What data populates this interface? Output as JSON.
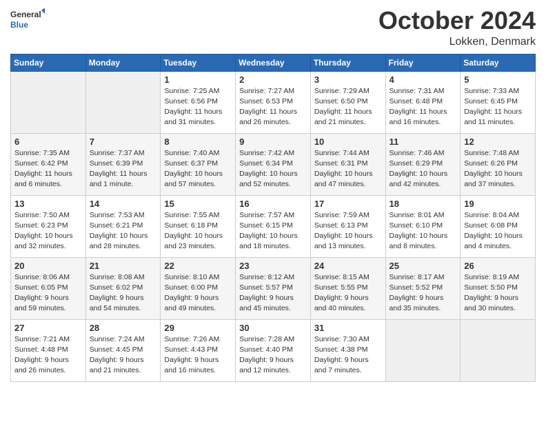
{
  "header": {
    "logo": {
      "general": "General",
      "blue": "Blue"
    },
    "month": "October 2024",
    "location": "Lokken, Denmark"
  },
  "weekdays": [
    "Sunday",
    "Monday",
    "Tuesday",
    "Wednesday",
    "Thursday",
    "Friday",
    "Saturday"
  ],
  "weeks": [
    [
      {
        "day": "",
        "sunrise": "",
        "sunset": "",
        "daylight": ""
      },
      {
        "day": "",
        "sunrise": "",
        "sunset": "",
        "daylight": ""
      },
      {
        "day": "1",
        "sunrise": "Sunrise: 7:25 AM",
        "sunset": "Sunset: 6:56 PM",
        "daylight": "Daylight: 11 hours and 31 minutes."
      },
      {
        "day": "2",
        "sunrise": "Sunrise: 7:27 AM",
        "sunset": "Sunset: 6:53 PM",
        "daylight": "Daylight: 11 hours and 26 minutes."
      },
      {
        "day": "3",
        "sunrise": "Sunrise: 7:29 AM",
        "sunset": "Sunset: 6:50 PM",
        "daylight": "Daylight: 11 hours and 21 minutes."
      },
      {
        "day": "4",
        "sunrise": "Sunrise: 7:31 AM",
        "sunset": "Sunset: 6:48 PM",
        "daylight": "Daylight: 11 hours and 16 minutes."
      },
      {
        "day": "5",
        "sunrise": "Sunrise: 7:33 AM",
        "sunset": "Sunset: 6:45 PM",
        "daylight": "Daylight: 11 hours and 11 minutes."
      }
    ],
    [
      {
        "day": "6",
        "sunrise": "Sunrise: 7:35 AM",
        "sunset": "Sunset: 6:42 PM",
        "daylight": "Daylight: 11 hours and 6 minutes."
      },
      {
        "day": "7",
        "sunrise": "Sunrise: 7:37 AM",
        "sunset": "Sunset: 6:39 PM",
        "daylight": "Daylight: 11 hours and 1 minute."
      },
      {
        "day": "8",
        "sunrise": "Sunrise: 7:40 AM",
        "sunset": "Sunset: 6:37 PM",
        "daylight": "Daylight: 10 hours and 57 minutes."
      },
      {
        "day": "9",
        "sunrise": "Sunrise: 7:42 AM",
        "sunset": "Sunset: 6:34 PM",
        "daylight": "Daylight: 10 hours and 52 minutes."
      },
      {
        "day": "10",
        "sunrise": "Sunrise: 7:44 AM",
        "sunset": "Sunset: 6:31 PM",
        "daylight": "Daylight: 10 hours and 47 minutes."
      },
      {
        "day": "11",
        "sunrise": "Sunrise: 7:46 AM",
        "sunset": "Sunset: 6:29 PM",
        "daylight": "Daylight: 10 hours and 42 minutes."
      },
      {
        "day": "12",
        "sunrise": "Sunrise: 7:48 AM",
        "sunset": "Sunset: 6:26 PM",
        "daylight": "Daylight: 10 hours and 37 minutes."
      }
    ],
    [
      {
        "day": "13",
        "sunrise": "Sunrise: 7:50 AM",
        "sunset": "Sunset: 6:23 PM",
        "daylight": "Daylight: 10 hours and 32 minutes."
      },
      {
        "day": "14",
        "sunrise": "Sunrise: 7:53 AM",
        "sunset": "Sunset: 6:21 PM",
        "daylight": "Daylight: 10 hours and 28 minutes."
      },
      {
        "day": "15",
        "sunrise": "Sunrise: 7:55 AM",
        "sunset": "Sunset: 6:18 PM",
        "daylight": "Daylight: 10 hours and 23 minutes."
      },
      {
        "day": "16",
        "sunrise": "Sunrise: 7:57 AM",
        "sunset": "Sunset: 6:15 PM",
        "daylight": "Daylight: 10 hours and 18 minutes."
      },
      {
        "day": "17",
        "sunrise": "Sunrise: 7:59 AM",
        "sunset": "Sunset: 6:13 PM",
        "daylight": "Daylight: 10 hours and 13 minutes."
      },
      {
        "day": "18",
        "sunrise": "Sunrise: 8:01 AM",
        "sunset": "Sunset: 6:10 PM",
        "daylight": "Daylight: 10 hours and 8 minutes."
      },
      {
        "day": "19",
        "sunrise": "Sunrise: 8:04 AM",
        "sunset": "Sunset: 6:08 PM",
        "daylight": "Daylight: 10 hours and 4 minutes."
      }
    ],
    [
      {
        "day": "20",
        "sunrise": "Sunrise: 8:06 AM",
        "sunset": "Sunset: 6:05 PM",
        "daylight": "Daylight: 9 hours and 59 minutes."
      },
      {
        "day": "21",
        "sunrise": "Sunrise: 8:08 AM",
        "sunset": "Sunset: 6:02 PM",
        "daylight": "Daylight: 9 hours and 54 minutes."
      },
      {
        "day": "22",
        "sunrise": "Sunrise: 8:10 AM",
        "sunset": "Sunset: 6:00 PM",
        "daylight": "Daylight: 9 hours and 49 minutes."
      },
      {
        "day": "23",
        "sunrise": "Sunrise: 8:12 AM",
        "sunset": "Sunset: 5:57 PM",
        "daylight": "Daylight: 9 hours and 45 minutes."
      },
      {
        "day": "24",
        "sunrise": "Sunrise: 8:15 AM",
        "sunset": "Sunset: 5:55 PM",
        "daylight": "Daylight: 9 hours and 40 minutes."
      },
      {
        "day": "25",
        "sunrise": "Sunrise: 8:17 AM",
        "sunset": "Sunset: 5:52 PM",
        "daylight": "Daylight: 9 hours and 35 minutes."
      },
      {
        "day": "26",
        "sunrise": "Sunrise: 8:19 AM",
        "sunset": "Sunset: 5:50 PM",
        "daylight": "Daylight: 9 hours and 30 minutes."
      }
    ],
    [
      {
        "day": "27",
        "sunrise": "Sunrise: 7:21 AM",
        "sunset": "Sunset: 4:48 PM",
        "daylight": "Daylight: 9 hours and 26 minutes."
      },
      {
        "day": "28",
        "sunrise": "Sunrise: 7:24 AM",
        "sunset": "Sunset: 4:45 PM",
        "daylight": "Daylight: 9 hours and 21 minutes."
      },
      {
        "day": "29",
        "sunrise": "Sunrise: 7:26 AM",
        "sunset": "Sunset: 4:43 PM",
        "daylight": "Daylight: 9 hours and 16 minutes."
      },
      {
        "day": "30",
        "sunrise": "Sunrise: 7:28 AM",
        "sunset": "Sunset: 4:40 PM",
        "daylight": "Daylight: 9 hours and 12 minutes."
      },
      {
        "day": "31",
        "sunrise": "Sunrise: 7:30 AM",
        "sunset": "Sunset: 4:38 PM",
        "daylight": "Daylight: 9 hours and 7 minutes."
      },
      {
        "day": "",
        "sunrise": "",
        "sunset": "",
        "daylight": ""
      },
      {
        "day": "",
        "sunrise": "",
        "sunset": "",
        "daylight": ""
      }
    ]
  ]
}
